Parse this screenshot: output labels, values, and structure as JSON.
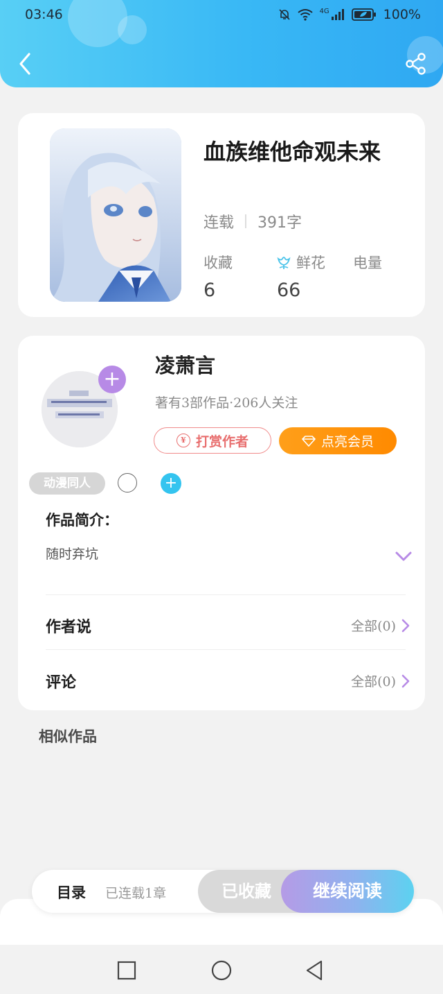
{
  "status_bar": {
    "time": "03:46",
    "battery": "100%",
    "network": "4G"
  },
  "header": {
    "back_icon": "chevron-left-icon",
    "share_icon": "share-icon",
    "gradient_colors": [
      "#58cff5",
      "#2fa8f2"
    ]
  },
  "book": {
    "title": "血族维他命观未来",
    "status": "连载",
    "word_count": "391字",
    "stats": [
      {
        "label": "收藏",
        "value": "6"
      },
      {
        "label": "鲜花",
        "value": "66",
        "icon": "flower-icon"
      },
      {
        "label": "电量",
        "value": ""
      }
    ]
  },
  "author": {
    "name": "凌萧言",
    "stats": "著有3部作品·206人关注",
    "follow_icon": "plus-icon",
    "reward_label": "打赏作者",
    "vip_label": "点亮会员",
    "vip_color": "#ff9408",
    "tag": "动漫同人"
  },
  "intro": {
    "title": "作品简介：",
    "text": "随时弃坑"
  },
  "sections": {
    "author_says": {
      "title": "作者说",
      "link": "全部(0)"
    },
    "comments": {
      "title": "评论",
      "link": "全部(0)"
    }
  },
  "similar": {
    "title": "相似作品"
  },
  "bottom_bar": {
    "toc_label": "目录",
    "toc_status": "已连载1章",
    "favorited_label": "已收藏",
    "continue_label": "继续阅读",
    "accent_color": "#b59be6"
  },
  "nav": {
    "items": [
      "square-icon",
      "circle-icon",
      "triangle-back-icon"
    ]
  }
}
